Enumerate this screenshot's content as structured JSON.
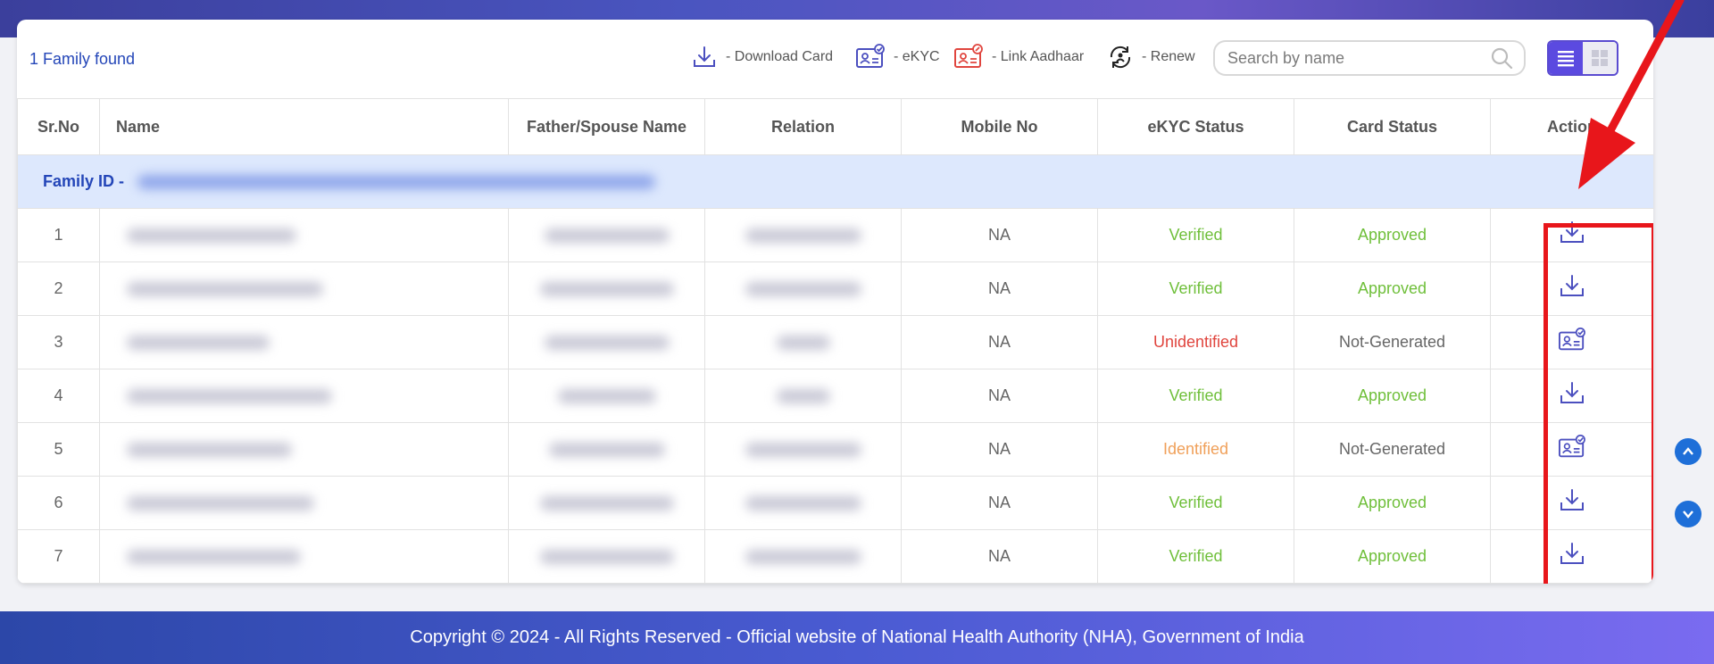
{
  "header": {
    "count_text": "1 Family found",
    "legend": [
      {
        "icon": "download-icon",
        "label": "- Download Card"
      },
      {
        "icon": "ekyc-icon",
        "label": "- eKYC"
      },
      {
        "icon": "link-aadhaar-icon",
        "label": "- Link Aadhaar"
      },
      {
        "icon": "renew-icon",
        "label": "- Renew"
      }
    ],
    "search": {
      "placeholder": "Search by name",
      "value": ""
    },
    "view_toggle": {
      "active": "list"
    }
  },
  "table": {
    "columns": [
      "Sr.No",
      "Name",
      "Father/Spouse Name",
      "Relation",
      "Mobile No",
      "eKYC Status",
      "Card Status",
      "Action"
    ],
    "family_label": "Family ID -",
    "rows": [
      {
        "sr": "1",
        "mobile": "NA",
        "ekyc": "Verified",
        "ekyc_color": "#6fbf3a",
        "card": "Approved",
        "card_color": "#6fbf3a",
        "action": "download-icon"
      },
      {
        "sr": "2",
        "mobile": "NA",
        "ekyc": "Verified",
        "ekyc_color": "#6fbf3a",
        "card": "Approved",
        "card_color": "#6fbf3a",
        "action": "download-icon"
      },
      {
        "sr": "3",
        "mobile": "NA",
        "ekyc": "Unidentified",
        "ekyc_color": "#e0453e",
        "card": "Not-Generated",
        "card_color": "#666666",
        "action": "ekyc-icon"
      },
      {
        "sr": "4",
        "mobile": "NA",
        "ekyc": "Verified",
        "ekyc_color": "#6fbf3a",
        "card": "Approved",
        "card_color": "#6fbf3a",
        "action": "download-icon"
      },
      {
        "sr": "5",
        "mobile": "NA",
        "ekyc": "Identified",
        "ekyc_color": "#f0a05a",
        "card": "Not-Generated",
        "card_color": "#666666",
        "action": "ekyc-icon"
      },
      {
        "sr": "6",
        "mobile": "NA",
        "ekyc": "Verified",
        "ekyc_color": "#6fbf3a",
        "card": "Approved",
        "card_color": "#6fbf3a",
        "action": "download-icon"
      },
      {
        "sr": "7",
        "mobile": "NA",
        "ekyc": "Verified",
        "ekyc_color": "#6fbf3a",
        "card": "Approved",
        "card_color": "#6fbf3a",
        "action": "download-icon"
      }
    ]
  },
  "scroll_buttons": [
    "chevron-up-icon",
    "chevron-down-icon"
  ],
  "footer": {
    "text": "Copyright © 2024 - All Rights Reserved - Official website of National Health Authority (NHA), Government of India"
  },
  "colors": {
    "accent": "#2446b8",
    "toggle_active": "#5b4ae0",
    "highlight": "#e8161b",
    "family_row_bg": "#dde8fd"
  }
}
